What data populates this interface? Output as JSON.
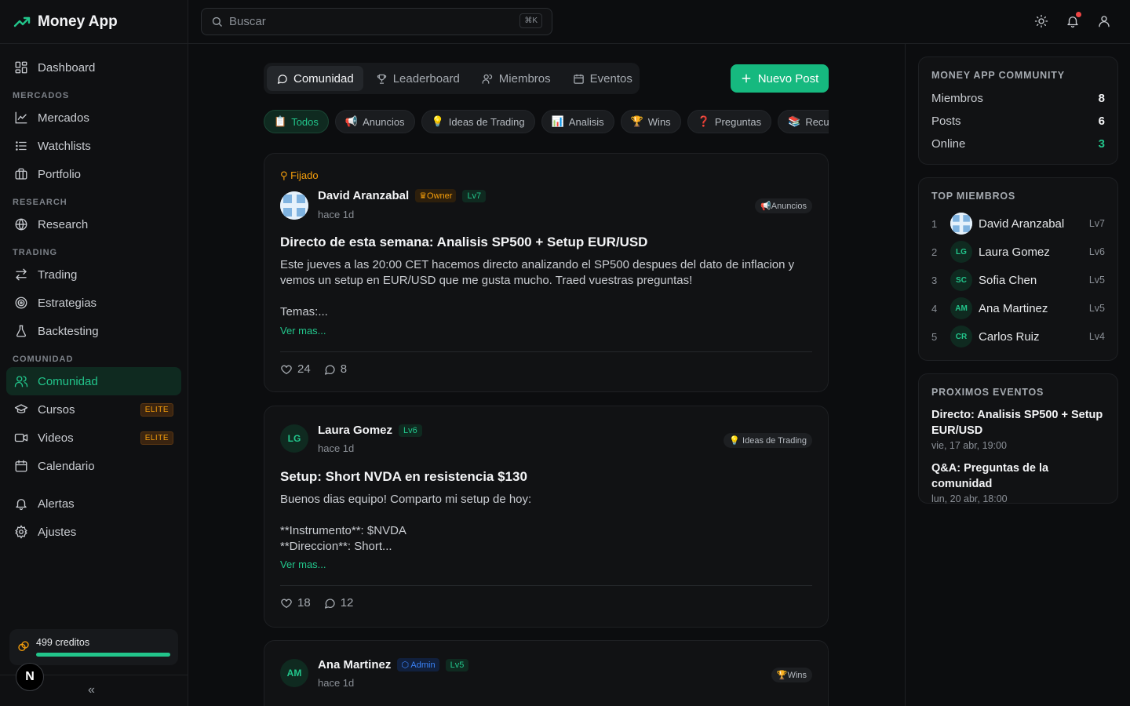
{
  "app": {
    "title": "Money App"
  },
  "sidebar": {
    "items": [
      {
        "label": "Dashboard"
      },
      {
        "section": "MERCADOS"
      },
      {
        "label": "Mercados"
      },
      {
        "label": "Watchlists"
      },
      {
        "label": "Portfolio"
      },
      {
        "section": "RESEARCH"
      },
      {
        "label": "Research"
      },
      {
        "section": "TRADING"
      },
      {
        "label": "Trading"
      },
      {
        "label": "Estrategias"
      },
      {
        "label": "Backtesting"
      },
      {
        "section": "COMUNIDAD"
      },
      {
        "label": "Comunidad"
      },
      {
        "label": "Cursos",
        "badge": "ELITE"
      },
      {
        "label": "Videos",
        "badge": "ELITE"
      },
      {
        "label": "Calendario"
      },
      {
        "label": "Alertas"
      },
      {
        "label": "Ajustes"
      }
    ],
    "credits": {
      "label": "499 creditos",
      "progress": 1.0
    },
    "user_initial": "N",
    "collapse_glyph": "«"
  },
  "topbar": {
    "search_placeholder": "Buscar",
    "shortcut": "⌘K"
  },
  "tabs": [
    {
      "label": "Comunidad"
    },
    {
      "label": "Leaderboard"
    },
    {
      "label": "Miembros"
    },
    {
      "label": "Eventos"
    }
  ],
  "new_post_label": "Nuevo Post",
  "categories": [
    {
      "emoji": "📋",
      "label": "Todos"
    },
    {
      "emoji": "📢",
      "label": "Anuncios"
    },
    {
      "emoji": "💡",
      "label": "Ideas de Trading"
    },
    {
      "emoji": "📊",
      "label": "Analisis"
    },
    {
      "emoji": "🏆",
      "label": "Wins"
    },
    {
      "emoji": "❓",
      "label": "Preguntas"
    },
    {
      "emoji": "📚",
      "label": "Recursos"
    }
  ],
  "posts": [
    {
      "pinned": "Fijado",
      "author": "David Aranzabal",
      "role": "Owner",
      "level": "Lv7",
      "time": "hace 1d",
      "category": "📢Anuncios",
      "title": "Directo de esta semana: Analisis SP500 + Setup EUR/USD",
      "body": "Este jueves a las 20:00 CET hacemos directo analizando el SP500 despues del dato de inflacion y vemos un setup en EUR/USD que me gusta mucho. Traed vuestras preguntas!\n\nTemas:...",
      "more": "Ver mas...",
      "likes": "24",
      "comments": "8"
    },
    {
      "initials": "LG",
      "author": "Laura Gomez",
      "level": "Lv6",
      "time": "hace 1d",
      "category": "💡 Ideas de Trading",
      "title": "Setup: Short NVDA en resistencia $130",
      "body": "Buenos dias equipo! Comparto mi setup de hoy:\n\n**Instrumento**: $NVDA\n**Direccion**: Short...",
      "more": "Ver mas...",
      "likes": "18",
      "comments": "12"
    },
    {
      "initials": "AM",
      "author": "Ana Martinez",
      "role": "Admin",
      "level": "Lv5",
      "time": "hace 1d",
      "category": "🏆Wins"
    }
  ],
  "community": {
    "title": "MONEY APP COMMUNITY",
    "rows": [
      {
        "label": "Miembros",
        "value": "8"
      },
      {
        "label": "Posts",
        "value": "6"
      },
      {
        "label": "Online",
        "value": "3"
      }
    ]
  },
  "top_members": {
    "title": "TOP MIEMBROS",
    "items": [
      {
        "rank": "1",
        "initials": "",
        "name": "David Aranzabal",
        "level": "Lv7"
      },
      {
        "rank": "2",
        "initials": "LG",
        "name": "Laura Gomez",
        "level": "Lv6"
      },
      {
        "rank": "3",
        "initials": "SC",
        "name": "Sofia Chen",
        "level": "Lv5"
      },
      {
        "rank": "4",
        "initials": "AM",
        "name": "Ana Martinez",
        "level": "Lv5"
      },
      {
        "rank": "5",
        "initials": "CR",
        "name": "Carlos Ruiz",
        "level": "Lv4"
      }
    ]
  },
  "events": {
    "title": "PROXIMOS EVENTOS",
    "items": [
      {
        "title": "Directo: Analisis SP500 + Setup EUR/USD",
        "date": "vie, 17 abr, 19:00"
      },
      {
        "title": "Q&A: Preguntas de la comunidad",
        "date": "lun, 20 abr, 18:00"
      }
    ]
  },
  "colors": {
    "accent": "#22c58b",
    "accent_bg": "#0f2a20",
    "owner": "#f59e0b",
    "admin": "#3b82f6",
    "elite": "#f59e0b"
  }
}
